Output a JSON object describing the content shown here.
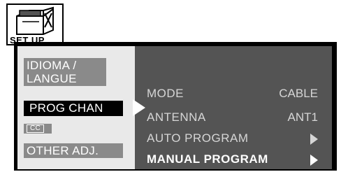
{
  "setup": {
    "label": "SET UP",
    "icon": "toolbox-icon"
  },
  "left_menu": {
    "idioma_line1": "IDIOMA /",
    "idioma_line2": "LANGUE",
    "prog_chan": "PROG CHAN",
    "cc": "CC",
    "other_adj": "OTHER ADJ."
  },
  "right_menu": {
    "rows": [
      {
        "label": "MODE",
        "value": "CABLE"
      },
      {
        "label": "ANTENNA",
        "value": "ANT1"
      },
      {
        "label": "AUTO PROGRAM",
        "value": ""
      },
      {
        "label": "MANUAL PROGRAM",
        "value": ""
      }
    ],
    "selected_index": 3
  },
  "colors": {
    "frame": "#000000",
    "left_panel": "#e9e9e9",
    "right_panel": "#545454",
    "dim_item": "#8a8a8a"
  }
}
